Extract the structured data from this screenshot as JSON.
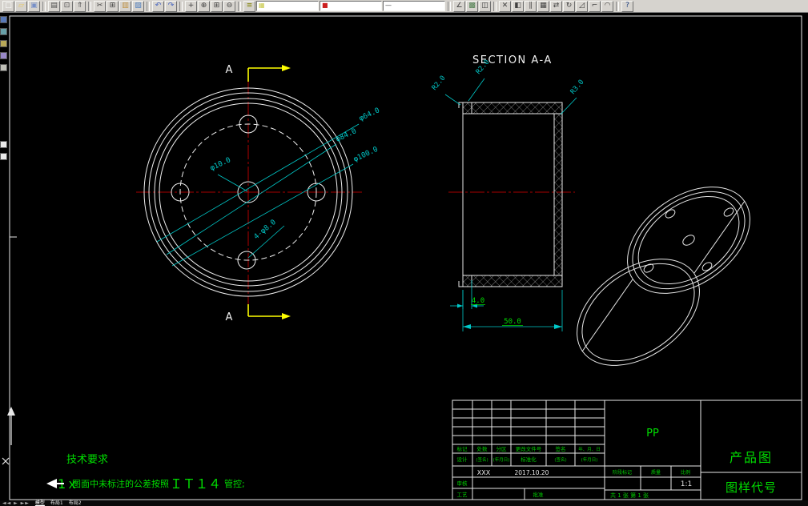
{
  "window": {
    "canvas_bg": "#000000",
    "chrome_bg": "#d6d3ce",
    "line_color": "#f0f0f0",
    "dim_color": "#00c8c8",
    "green_color": "#00dd00",
    "center_color": "#dd0000",
    "section_arrow_color": "#ffff00"
  },
  "toolbar": {
    "items": [
      {
        "name": "new-file-icon",
        "type": "button",
        "glyph": "□",
        "color": "#ffffff"
      },
      {
        "name": "open-file-icon",
        "type": "button",
        "glyph": "▱",
        "color": "#e8c860"
      },
      {
        "name": "save-icon",
        "type": "button",
        "glyph": "▣",
        "color": "#7890c8"
      },
      {
        "name": "toolbar-separator",
        "type": "separator"
      },
      {
        "name": "plot-icon",
        "type": "button",
        "glyph": "▤",
        "color": "#505050"
      },
      {
        "name": "plot-preview-icon",
        "type": "button",
        "glyph": "⊡",
        "color": "#505050"
      },
      {
        "name": "publish-icon",
        "type": "button",
        "glyph": "⇑",
        "color": "#505050"
      },
      {
        "name": "toolbar-separator",
        "type": "separator"
      },
      {
        "name": "cut-icon",
        "type": "button",
        "glyph": "✂",
        "color": "#404040"
      },
      {
        "name": "copy-icon",
        "type": "button",
        "glyph": "⊞",
        "color": "#404040"
      },
      {
        "name": "paste-icon",
        "type": "button",
        "glyph": "▥",
        "color": "#c09040"
      },
      {
        "name": "match-properties-icon",
        "type": "button",
        "glyph": "▨",
        "color": "#5080c0"
      },
      {
        "name": "toolbar-separator",
        "type": "separator"
      },
      {
        "name": "undo-icon",
        "type": "button",
        "glyph": "↶",
        "color": "#4060c0"
      },
      {
        "name": "redo-icon",
        "type": "button",
        "glyph": "↷",
        "color": "#4060c0"
      },
      {
        "name": "toolbar-separator",
        "type": "separator"
      },
      {
        "name": "pan-icon",
        "type": "button",
        "glyph": "+",
        "color": "#404040"
      },
      {
        "name": "zoom-realtime-icon",
        "type": "button",
        "glyph": "⊕",
        "color": "#404040"
      },
      {
        "name": "zoom-window-icon",
        "type": "button",
        "glyph": "⊞",
        "color": "#404040"
      },
      {
        "name": "zoom-previous-icon",
        "type": "button",
        "glyph": "⊖",
        "color": "#404040"
      },
      {
        "name": "toolbar-separator",
        "type": "separator"
      },
      {
        "name": "layer-properties-icon",
        "type": "button",
        "glyph": "≡",
        "color": "#808000"
      },
      {
        "name": "layer-combo",
        "type": "combo",
        "glyph": "▦",
        "color": "#c8c848"
      },
      {
        "name": "color-combo",
        "type": "combo",
        "glyph": "■",
        "color": "#cc2020"
      },
      {
        "name": "linetype-combo",
        "type": "combo",
        "glyph": "—",
        "color": "#404040"
      },
      {
        "name": "toolbar-separator",
        "type": "separator"
      },
      {
        "name": "distance-icon",
        "type": "button",
        "glyph": "∠",
        "color": "#404040"
      },
      {
        "name": "properties-icon",
        "type": "button",
        "glyph": "▩",
        "color": "#508050"
      },
      {
        "name": "designcenter-icon",
        "type": "button",
        "glyph": "◫",
        "color": "#404040"
      },
      {
        "name": "toolbar-separator",
        "type": "separator"
      },
      {
        "name": "erase-icon",
        "type": "button",
        "glyph": "✕",
        "color": "#404040"
      },
      {
        "name": "mirror-icon",
        "type": "button",
        "glyph": "◧",
        "color": "#404040"
      },
      {
        "name": "offset-icon",
        "type": "button",
        "glyph": "∥",
        "color": "#404040"
      },
      {
        "name": "array-icon",
        "type": "button",
        "glyph": "▦",
        "color": "#404040"
      },
      {
        "name": "move-icon",
        "type": "button",
        "glyph": "⇄",
        "color": "#404040"
      },
      {
        "name": "rotate-icon",
        "type": "button",
        "glyph": "↻",
        "color": "#404040"
      },
      {
        "name": "scale-icon",
        "type": "button",
        "glyph": "◿",
        "color": "#404040"
      },
      {
        "name": "trim-icon",
        "type": "button",
        "glyph": "⌐",
        "color": "#404040"
      },
      {
        "name": "fillet-icon",
        "type": "button",
        "glyph": "◠",
        "color": "#404040"
      },
      {
        "name": "toolbar-separator",
        "type": "separator"
      },
      {
        "name": "help-icon",
        "type": "button",
        "glyph": "?",
        "color": "#204080"
      }
    ]
  },
  "left_toolbar": {
    "top_icons": [
      {
        "name": "docked-tool-icon-1",
        "color": "#5878b8"
      },
      {
        "name": "docked-tool-icon-2",
        "color": "#68a0a8"
      },
      {
        "name": "docked-tool-icon-3",
        "color": "#b8a858"
      },
      {
        "name": "docked-tool-icon-4",
        "color": "#9888c8"
      },
      {
        "name": "docked-tool-icon-5",
        "color": "#c0c0b8"
      }
    ],
    "mid_icons": [
      {
        "name": "docked-tool-icon-6",
        "color": "#e8e8e8"
      },
      {
        "name": "docked-tool-icon-7",
        "color": "#e8e8e8"
      }
    ]
  },
  "drawing": {
    "front_view": {
      "label_top": "A",
      "label_bottom": "A",
      "dim_d64": "φ64.0",
      "dim_d84": "φ84.0",
      "dim_d100": "φ100.0",
      "dim_d10": "φ10.0",
      "dim_holes": "4-φ8.0"
    },
    "section_view": {
      "title": "SECTION  A-A",
      "dim_r2_left": "R2.0",
      "dim_r2_top": "R2.0",
      "dim_r3": "R3.0",
      "dim_thickness": "4.0",
      "dim_length": "50.0"
    },
    "tech_req": {
      "heading": "技术要求",
      "item_no": "1ｘ",
      "item_text": "图面中未标注的公差按照",
      "item_std": "ＩＴ１４",
      "item_tail": "管控;"
    },
    "title_block": {
      "material": "PP",
      "product_title": "产品图",
      "code_label": "图样代号",
      "scale_value": "1:1",
      "designer_name": "XXX",
      "design_date": "2017.10.20",
      "col_mark": "标记",
      "col_count": "处数",
      "col_zone": "分区",
      "col_change_doc": "更改文件号",
      "col_sign": "签名",
      "col_date": "年、月、日",
      "row_design": "设计",
      "row_sign": "(签名)",
      "row_date": "(年月日)",
      "row_standard": "标准化",
      "row_sign2": "(签名)",
      "row_date2": "(年月日)",
      "row_check": "审核",
      "row_process": "工艺",
      "row_approve": "批准",
      "stage_label": "阶段标记",
      "mass_label": "质量",
      "scale_label": "比例",
      "sheet_info": "共 1 张  第 1 张"
    }
  },
  "statusbar": {
    "nav": "◄◄ ► ►►",
    "tabs": [
      "模型",
      "布局1",
      "布局2"
    ]
  }
}
